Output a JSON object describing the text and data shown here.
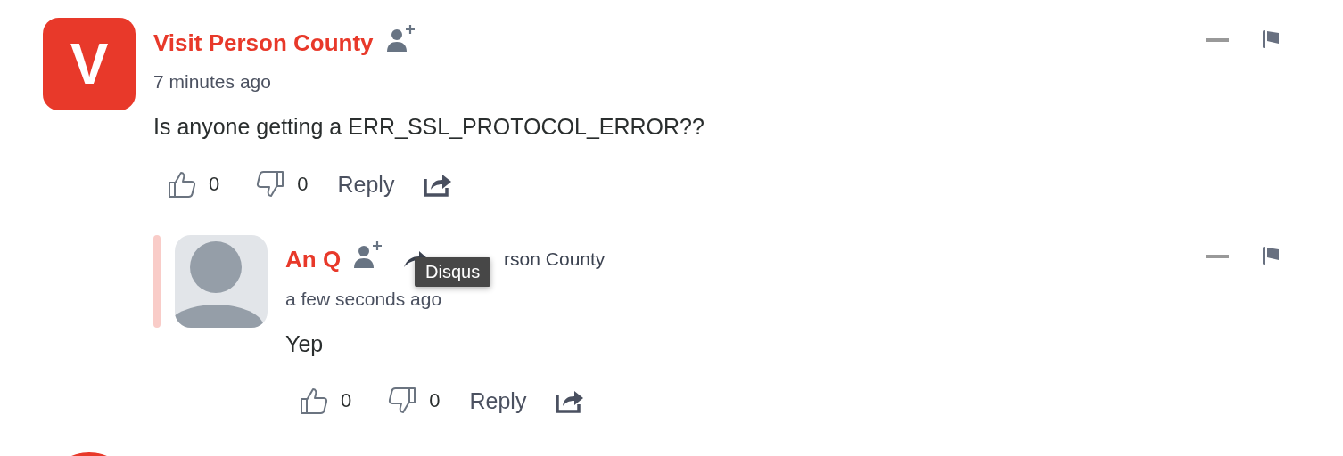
{
  "comments": [
    {
      "kind": "comment",
      "author": "Visit Person County",
      "avatar_letter": "V",
      "time": "7 minutes ago",
      "text": "Is anyone getting a ERR_SSL_PROTOCOL_ERROR??",
      "likes": "0",
      "dislikes": "0",
      "reply_label": "Reply",
      "replies": [
        {
          "author": "An Q",
          "in_reply_to": "rson County",
          "tooltip": "Disqus",
          "time": "a few seconds ago",
          "text": "Yep",
          "likes": "0",
          "dislikes": "0",
          "reply_label": "Reply"
        }
      ]
    },
    {
      "kind": "cut_off"
    }
  ]
}
